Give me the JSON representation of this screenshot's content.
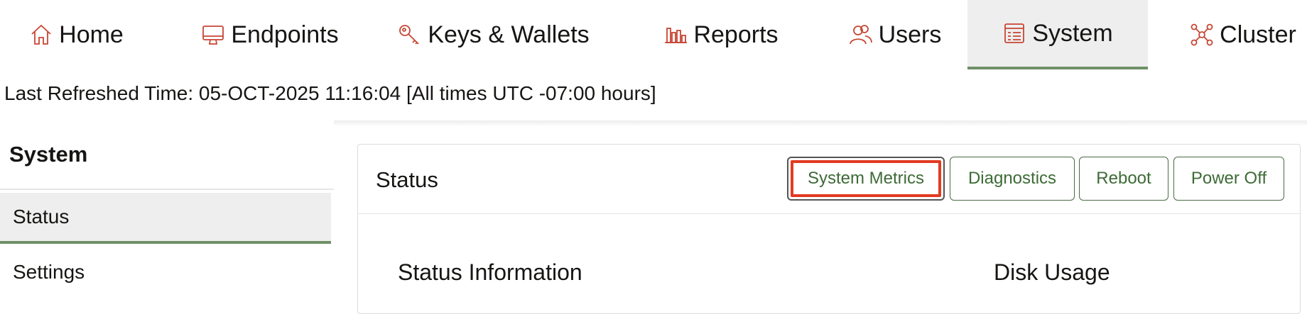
{
  "nav": {
    "items": [
      {
        "label": "Home",
        "icon": "home-icon"
      },
      {
        "label": "Endpoints",
        "icon": "monitor-icon"
      },
      {
        "label": "Keys & Wallets",
        "icon": "key-icon"
      },
      {
        "label": "Reports",
        "icon": "bar-chart-icon"
      },
      {
        "label": "Users",
        "icon": "users-icon"
      },
      {
        "label": "System",
        "icon": "system-icon",
        "selected": true
      },
      {
        "label": "Cluster",
        "icon": "cluster-icon"
      }
    ],
    "icon_color": "#c74634",
    "selected_underline_color": "#6f9067"
  },
  "refresh": {
    "text": "Last Refreshed Time: 05-OCT-2025 11:16:04 [All times UTC -07:00 hours]"
  },
  "sidebar": {
    "title": "System",
    "items": [
      {
        "label": "Status",
        "selected": true
      },
      {
        "label": "Settings"
      }
    ]
  },
  "panel": {
    "title": "Status",
    "buttons": [
      {
        "label": "System Metrics",
        "highlighted": true
      },
      {
        "label": "Diagnostics"
      },
      {
        "label": "Reboot"
      },
      {
        "label": "Power Off"
      }
    ],
    "button_color": "#3d6b36",
    "highlight_color": "#e23b22",
    "sections": {
      "status_information": "Status Information",
      "disk_usage": "Disk Usage"
    }
  }
}
